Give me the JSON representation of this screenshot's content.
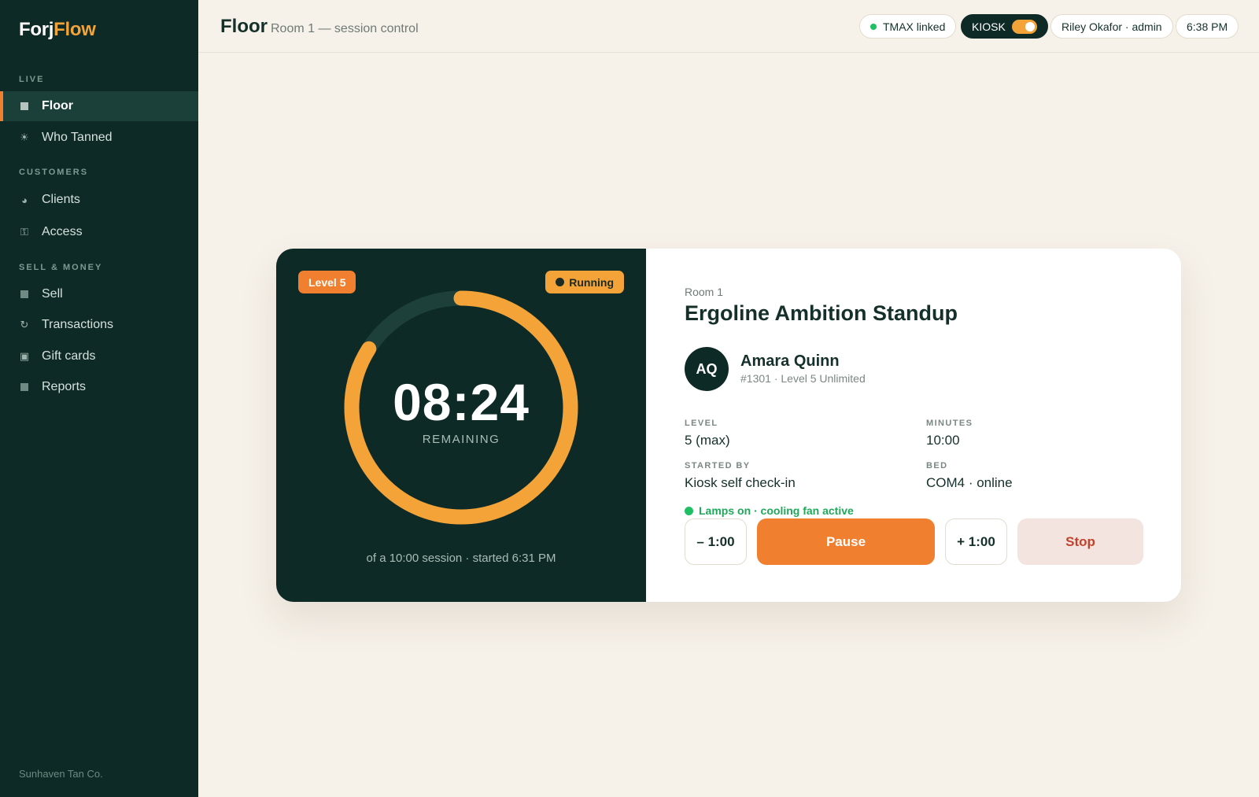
{
  "brand": {
    "part1": "Forj",
    "part2": "Flow"
  },
  "sidebar": {
    "sections": [
      {
        "label": "LIVE"
      },
      {
        "label": "CUSTOMERS"
      },
      {
        "label": "SELL & MONEY"
      }
    ],
    "items": [
      {
        "label": "Floor",
        "icon": "grid-square-icon",
        "active": true
      },
      {
        "label": "Who Tanned",
        "icon": "sun-icon"
      },
      {
        "label": "Clients",
        "icon": "user-icon"
      },
      {
        "label": "Access",
        "icon": "key-icon"
      },
      {
        "label": "Sell",
        "icon": "tag-icon"
      },
      {
        "label": "Transactions",
        "icon": "refresh-icon"
      },
      {
        "label": "Gift cards",
        "icon": "gift-card-icon"
      },
      {
        "label": "Reports",
        "icon": "report-icon"
      }
    ],
    "footer": "Sunhaven Tan Co."
  },
  "header": {
    "title": "Floor",
    "subtitle": "Room 1 — session control",
    "tmax": "TMAX linked",
    "kiosk": "KIOSK",
    "kiosk_on": true,
    "user": "Riley Okafor · admin",
    "clock": "6:38 PM"
  },
  "session": {
    "level_badge": "Level 5",
    "status": "Running",
    "time_remaining": "08:24",
    "remaining_label": "REMAINING",
    "note": "of a 10:00 session · started 6:31 PM",
    "progress_remaining": 0.84,
    "room": "Room 1",
    "bed": "Ergoline Ambition Standup",
    "client": {
      "initials": "AQ",
      "name": "Amara Quinn",
      "meta": "#1301 · Level 5 Unlimited"
    },
    "facts": {
      "level_label": "LEVEL",
      "level": "5 (max)",
      "minutes_label": "MINUTES",
      "minutes": "10:00",
      "started_by_label": "STARTED BY",
      "started_by": "Kiosk self check-in",
      "bed_label": "BED",
      "bed": "COM4 · online"
    },
    "lamp_status": "Lamps on · cooling fan active",
    "actions": {
      "minus": "– 1:00",
      "pause": "Pause",
      "plus": "+ 1:00",
      "stop": "Stop"
    }
  },
  "colors": {
    "sidebar_bg": "#0e2a26",
    "accent_orange": "#f07f2f",
    "ring_orange": "#f4a338",
    "ring_track": "#1d413a",
    "online_green": "#1fbf63",
    "stop_red": "#c0432c"
  }
}
